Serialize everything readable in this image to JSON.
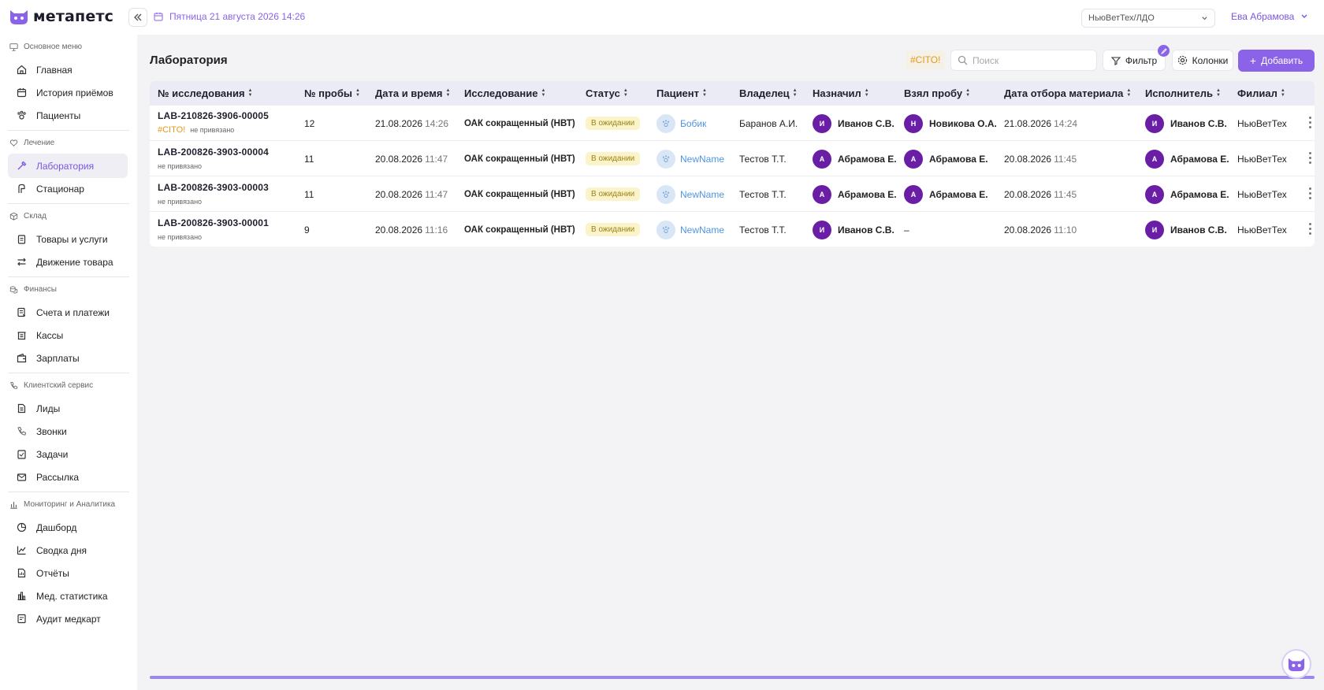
{
  "app": {
    "logo_text": "метапетс",
    "brand_color": "#8a63e8"
  },
  "header": {
    "date": "Пятница 21 августа 2026 14:26",
    "branch": "НьюВетТех/ЛДО",
    "user": "Ева Абрамова"
  },
  "sidebar": {
    "sections": [
      {
        "title": "Основное меню",
        "icon": "monitor-icon",
        "items": [
          {
            "label": "Главная",
            "icon": "home-icon"
          },
          {
            "label": "История приёмов",
            "icon": "calendar-icon"
          },
          {
            "label": "Пациенты",
            "icon": "paw-icon"
          }
        ]
      },
      {
        "title": "Лечение",
        "icon": "heart-icon",
        "items": [
          {
            "label": "Лаборатория",
            "icon": "pipette-icon",
            "active": true
          },
          {
            "label": "Стационар",
            "icon": "bed-icon"
          }
        ]
      },
      {
        "title": "Склад",
        "icon": "box-icon",
        "items": [
          {
            "label": "Товары и услуги",
            "icon": "clipboard-icon"
          },
          {
            "label": "Движение товара",
            "icon": "arrows-icon"
          }
        ]
      },
      {
        "title": "Финансы",
        "icon": "coins-icon",
        "items": [
          {
            "label": "Счета и платежи",
            "icon": "invoice-icon"
          },
          {
            "label": "Кассы",
            "icon": "register-icon"
          },
          {
            "label": "Зарплаты",
            "icon": "wallet-icon"
          }
        ]
      },
      {
        "title": "Клиентский сервис",
        "icon": "phone-icon",
        "items": [
          {
            "label": "Лиды",
            "icon": "document-icon"
          },
          {
            "label": "Звонки",
            "icon": "phone-icon"
          },
          {
            "label": "Задачи",
            "icon": "task-icon"
          },
          {
            "label": "Рассылка",
            "icon": "mail-icon"
          }
        ]
      },
      {
        "title": "Мониторинг и Аналитика",
        "icon": "bar-chart-icon",
        "items": [
          {
            "label": "Дашборд",
            "icon": "pie-icon"
          },
          {
            "label": "Сводка дня",
            "icon": "line-chart-icon"
          },
          {
            "label": "Отчёты",
            "icon": "report-icon"
          },
          {
            "label": "Мед. статистика",
            "icon": "stats-icon"
          },
          {
            "label": "Аудит медкарт",
            "icon": "audit-icon"
          }
        ]
      }
    ]
  },
  "main": {
    "title": "Лаборатория",
    "cito_chip": "#CITO!",
    "search_placeholder": "Поиск",
    "filter_label": "Фильтр",
    "columns_label": "Колонки",
    "add_label": "Добавить"
  },
  "table": {
    "columns": [
      "№ исследования",
      "№ пробы",
      "Дата и время",
      "Исследование",
      "Статус",
      "Пациент",
      "Владелец",
      "Назначил",
      "Взял пробу",
      "Дата отбора материала",
      "Исполнитель",
      "Филиал"
    ],
    "rows": [
      {
        "id": "LAB-210826-3906-00005",
        "cito": "#CITO!",
        "link": "не привязано",
        "sample": "12",
        "date": "21.08.2026",
        "time": "14:26",
        "study": "ОАК сокращенный (НВТ)",
        "status": "В ожидании",
        "patient": "Бобик",
        "owner": "Баранов А.И.",
        "assigned_initial": "И",
        "assigned": "Иванов С.В.",
        "taker_initial": "Н",
        "taker": "Новикова О.А.",
        "sample_date": "21.08.2026",
        "sample_time": "14:24",
        "executor_initial": "И",
        "executor": "Иванов С.В.",
        "branch": "НьюВетТех"
      },
      {
        "id": "LAB-200826-3903-00004",
        "cito": "",
        "link": "не привязано",
        "sample": "11",
        "date": "20.08.2026",
        "time": "11:47",
        "study": "ОАК сокращенный (НВТ)",
        "status": "В ожидании",
        "patient": "NewName",
        "owner": "Тестов Т.Т.",
        "assigned_initial": "А",
        "assigned": "Абрамова Е.",
        "taker_initial": "А",
        "taker": "Абрамова Е.",
        "sample_date": "20.08.2026",
        "sample_time": "11:45",
        "executor_initial": "А",
        "executor": "Абрамова Е.",
        "branch": "НьюВетТех"
      },
      {
        "id": "LAB-200826-3903-00003",
        "cito": "",
        "link": "не привязано",
        "sample": "11",
        "date": "20.08.2026",
        "time": "11:47",
        "study": "ОАК сокращенный (НВТ)",
        "status": "В ожидании",
        "patient": "NewName",
        "owner": "Тестов Т.Т.",
        "assigned_initial": "А",
        "assigned": "Абрамова Е.",
        "taker_initial": "А",
        "taker": "Абрамова Е.",
        "sample_date": "20.08.2026",
        "sample_time": "11:45",
        "executor_initial": "А",
        "executor": "Абрамова Е.",
        "branch": "НьюВетТех"
      },
      {
        "id": "LAB-200826-3903-00001",
        "cito": "",
        "link": "не привязано",
        "sample": "9",
        "date": "20.08.2026",
        "time": "11:16",
        "study": "ОАК сокращенный (НВТ)",
        "status": "В ожидании",
        "patient": "NewName",
        "owner": "Тестов Т.Т.",
        "assigned_initial": "И",
        "assigned": "Иванов С.В.",
        "taker_initial": "",
        "taker": "–",
        "sample_date": "20.08.2026",
        "sample_time": "11:10",
        "executor_initial": "И",
        "executor": "Иванов С.В.",
        "branch": "НьюВетТех"
      }
    ]
  }
}
